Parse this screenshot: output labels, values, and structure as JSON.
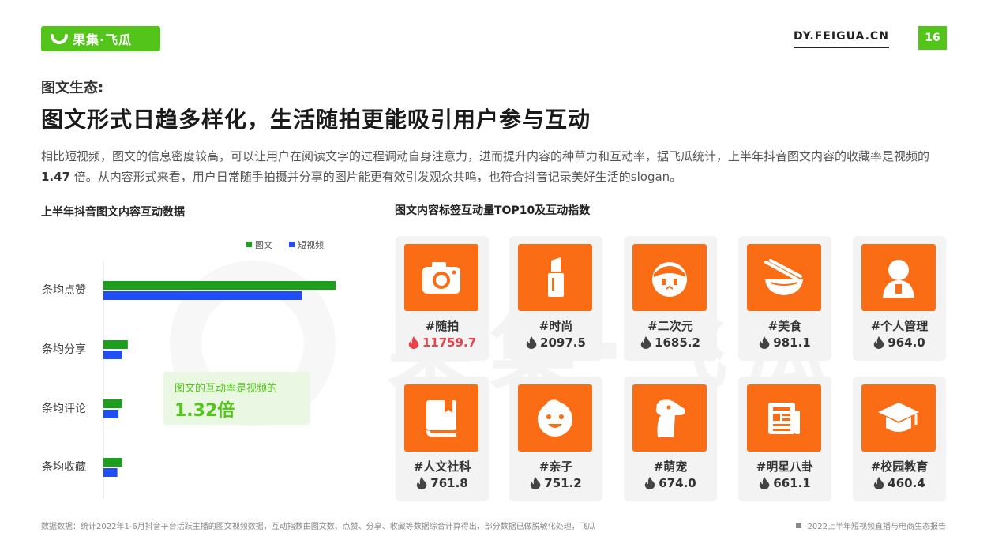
{
  "brand": {
    "name": "果集·飞瓜",
    "url": "DY.FEIGUA.CN",
    "page": "16",
    "green": "#52c41a",
    "orange": "#fa6d14"
  },
  "header": {
    "kicker": "图文生态:",
    "title": "图文形式日趋多样化，生活随拍更能吸引用户参与互动",
    "intro_1": "相比短视频，图文的信息密度较高，可以让用户在阅读文字的过程调动自身注意力，进而提升内容的种草力和互动率，据飞瓜统计，上半年抖音图文内容的收藏率是视频的",
    "intro_value": "1.47",
    "intro_2": "倍。从内容形式来看，用户日常随手拍摄并分享的图片能更有效引发观众共鸣，也符合抖音记录美好生活的slogan。"
  },
  "chart_data": {
    "type": "bar",
    "orientation": "horizontal",
    "title": "上半年抖音图文内容互动数据",
    "categories": [
      "条均点赞",
      "条均分享",
      "条均评论",
      "条均收藏"
    ],
    "series": [
      {
        "name": "图文",
        "color": "#1e9e1e",
        "values": [
          100,
          10.5,
          8,
          8
        ]
      },
      {
        "name": "短视频",
        "color": "#1f4ef5",
        "values": [
          85.5,
          8,
          6.5,
          6
        ]
      }
    ],
    "legend": "top-right",
    "grid": false,
    "annotation": {
      "line1": "图文的互动率是视频的",
      "line2": "1.32倍"
    }
  },
  "tag_grid": {
    "title": "图文内容标签互动量TOP10及互动指数",
    "items": [
      {
        "tag": "#随拍",
        "score": "11759.7",
        "icon": "camera-icon",
        "hot": true
      },
      {
        "tag": "#时尚",
        "score": "2097.5",
        "icon": "lipstick-icon",
        "hot": false
      },
      {
        "tag": "#二次元",
        "score": "1685.2",
        "icon": "anime-face-icon",
        "hot": false
      },
      {
        "tag": "#美食",
        "score": "981.1",
        "icon": "food-bowl-icon",
        "hot": false
      },
      {
        "tag": "#个人管理",
        "score": "964.0",
        "icon": "person-icon",
        "hot": false
      },
      {
        "tag": "#人文社科",
        "score": "761.8",
        "icon": "book-icon",
        "hot": false
      },
      {
        "tag": "#亲子",
        "score": "751.2",
        "icon": "baby-face-icon",
        "hot": false
      },
      {
        "tag": "#萌宠",
        "score": "674.0",
        "icon": "dog-icon",
        "hot": false
      },
      {
        "tag": "#明星八卦",
        "score": "661.1",
        "icon": "newspaper-icon",
        "hot": false
      },
      {
        "tag": "#校园教育",
        "score": "460.4",
        "icon": "graduation-cap-icon",
        "hot": false
      }
    ]
  },
  "footer": {
    "note": "数据数据：统计2022年1-6月抖音平台活跃主播的图文视频数据，互动指数由图文数、点赞、分享、收藏等数据综合计算得出，部分数据已做脱敏化处理，飞瓜",
    "report": "2022上半年短视频直播与电商生态报告"
  }
}
